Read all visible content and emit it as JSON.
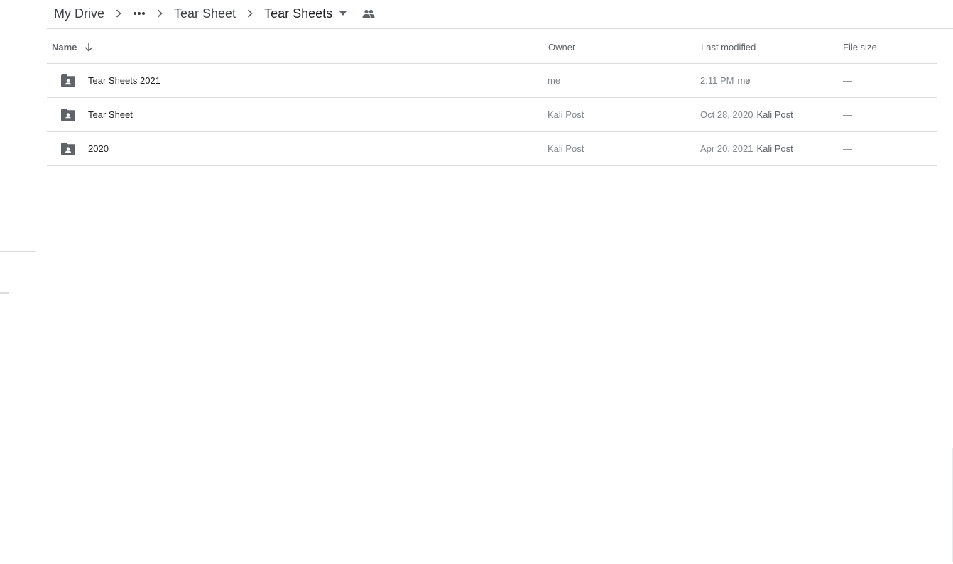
{
  "breadcrumb": {
    "root": "My Drive",
    "parent": "Tear Sheet",
    "current": "Tear Sheets"
  },
  "table": {
    "headers": {
      "name": "Name",
      "owner": "Owner",
      "last_modified": "Last modified",
      "file_size": "File size"
    },
    "sort": {
      "column": "name",
      "direction": "descending"
    },
    "rows": [
      {
        "type": "shared-folder",
        "name": "Tear Sheets 2021",
        "owner": "me",
        "modified_date": "2:11 PM",
        "modified_by": "me",
        "size": "—"
      },
      {
        "type": "shared-folder",
        "name": "Tear Sheet",
        "owner": "Kali Post",
        "modified_date": "Oct 28, 2020",
        "modified_by": "Kali Post",
        "size": "—"
      },
      {
        "type": "shared-folder",
        "name": "2020",
        "owner": "Kali Post",
        "modified_date": "Apr 20, 2021",
        "modified_by": "Kali Post",
        "size": "—"
      }
    ]
  },
  "colors": {
    "icon": "#5f6368",
    "divider": "#dadce0",
    "text_primary": "#202124",
    "text_secondary": "#80868b"
  }
}
